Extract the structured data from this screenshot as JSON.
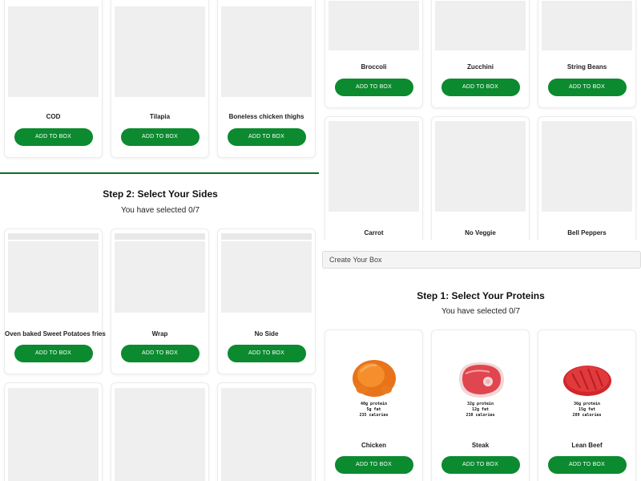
{
  "proteins_top": [
    {
      "name": "COD",
      "button": "ADD TO BOX"
    },
    {
      "name": "Tilapia",
      "button": "ADD TO BOX"
    },
    {
      "name": "Boneless chicken thighs",
      "button": "ADD TO BOX"
    }
  ],
  "step2": {
    "title": "Step 2: Select Your Sides",
    "selected": "You have selected 0/7",
    "items": [
      {
        "name": "Oven baked Sweet Potatoes fries",
        "button": "ADD TO BOX"
      },
      {
        "name": "Wrap",
        "button": "ADD TO BOX"
      },
      {
        "name": "No Side",
        "button": "ADD TO BOX"
      }
    ]
  },
  "veggies": [
    {
      "name": "Broccoli",
      "button": "ADD TO BOX"
    },
    {
      "name": "Zucchini",
      "button": "ADD TO BOX"
    },
    {
      "name": "String Beans",
      "button": "ADD TO BOX"
    },
    {
      "name": "Carrot"
    },
    {
      "name": "No Veggie"
    },
    {
      "name": "Bell Peppers"
    }
  ],
  "create_box": {
    "label": "Create Your Box"
  },
  "step1": {
    "title": "Step 1: Select Your Proteins",
    "selected": "You have selected 0/7",
    "items": [
      {
        "name": "Chicken",
        "button": "ADD TO BOX",
        "icon": "chicken-drumstick-icon",
        "protein": "40g protein",
        "fat": "5g fat",
        "calories": "235 calories"
      },
      {
        "name": "Steak",
        "button": "ADD TO BOX",
        "icon": "steak-icon",
        "protein": "32g protein",
        "fat": "12g fat",
        "calories": "238 calories"
      },
      {
        "name": "Lean Beef",
        "button": "ADD TO BOX",
        "icon": "lean-beef-icon",
        "protein": "36g protein",
        "fat": "15g fat",
        "calories": "289 calories"
      }
    ]
  },
  "colors": {
    "accent": "#0b8a2f",
    "divider": "#0b6e2a",
    "placeholder": "#efefef"
  }
}
